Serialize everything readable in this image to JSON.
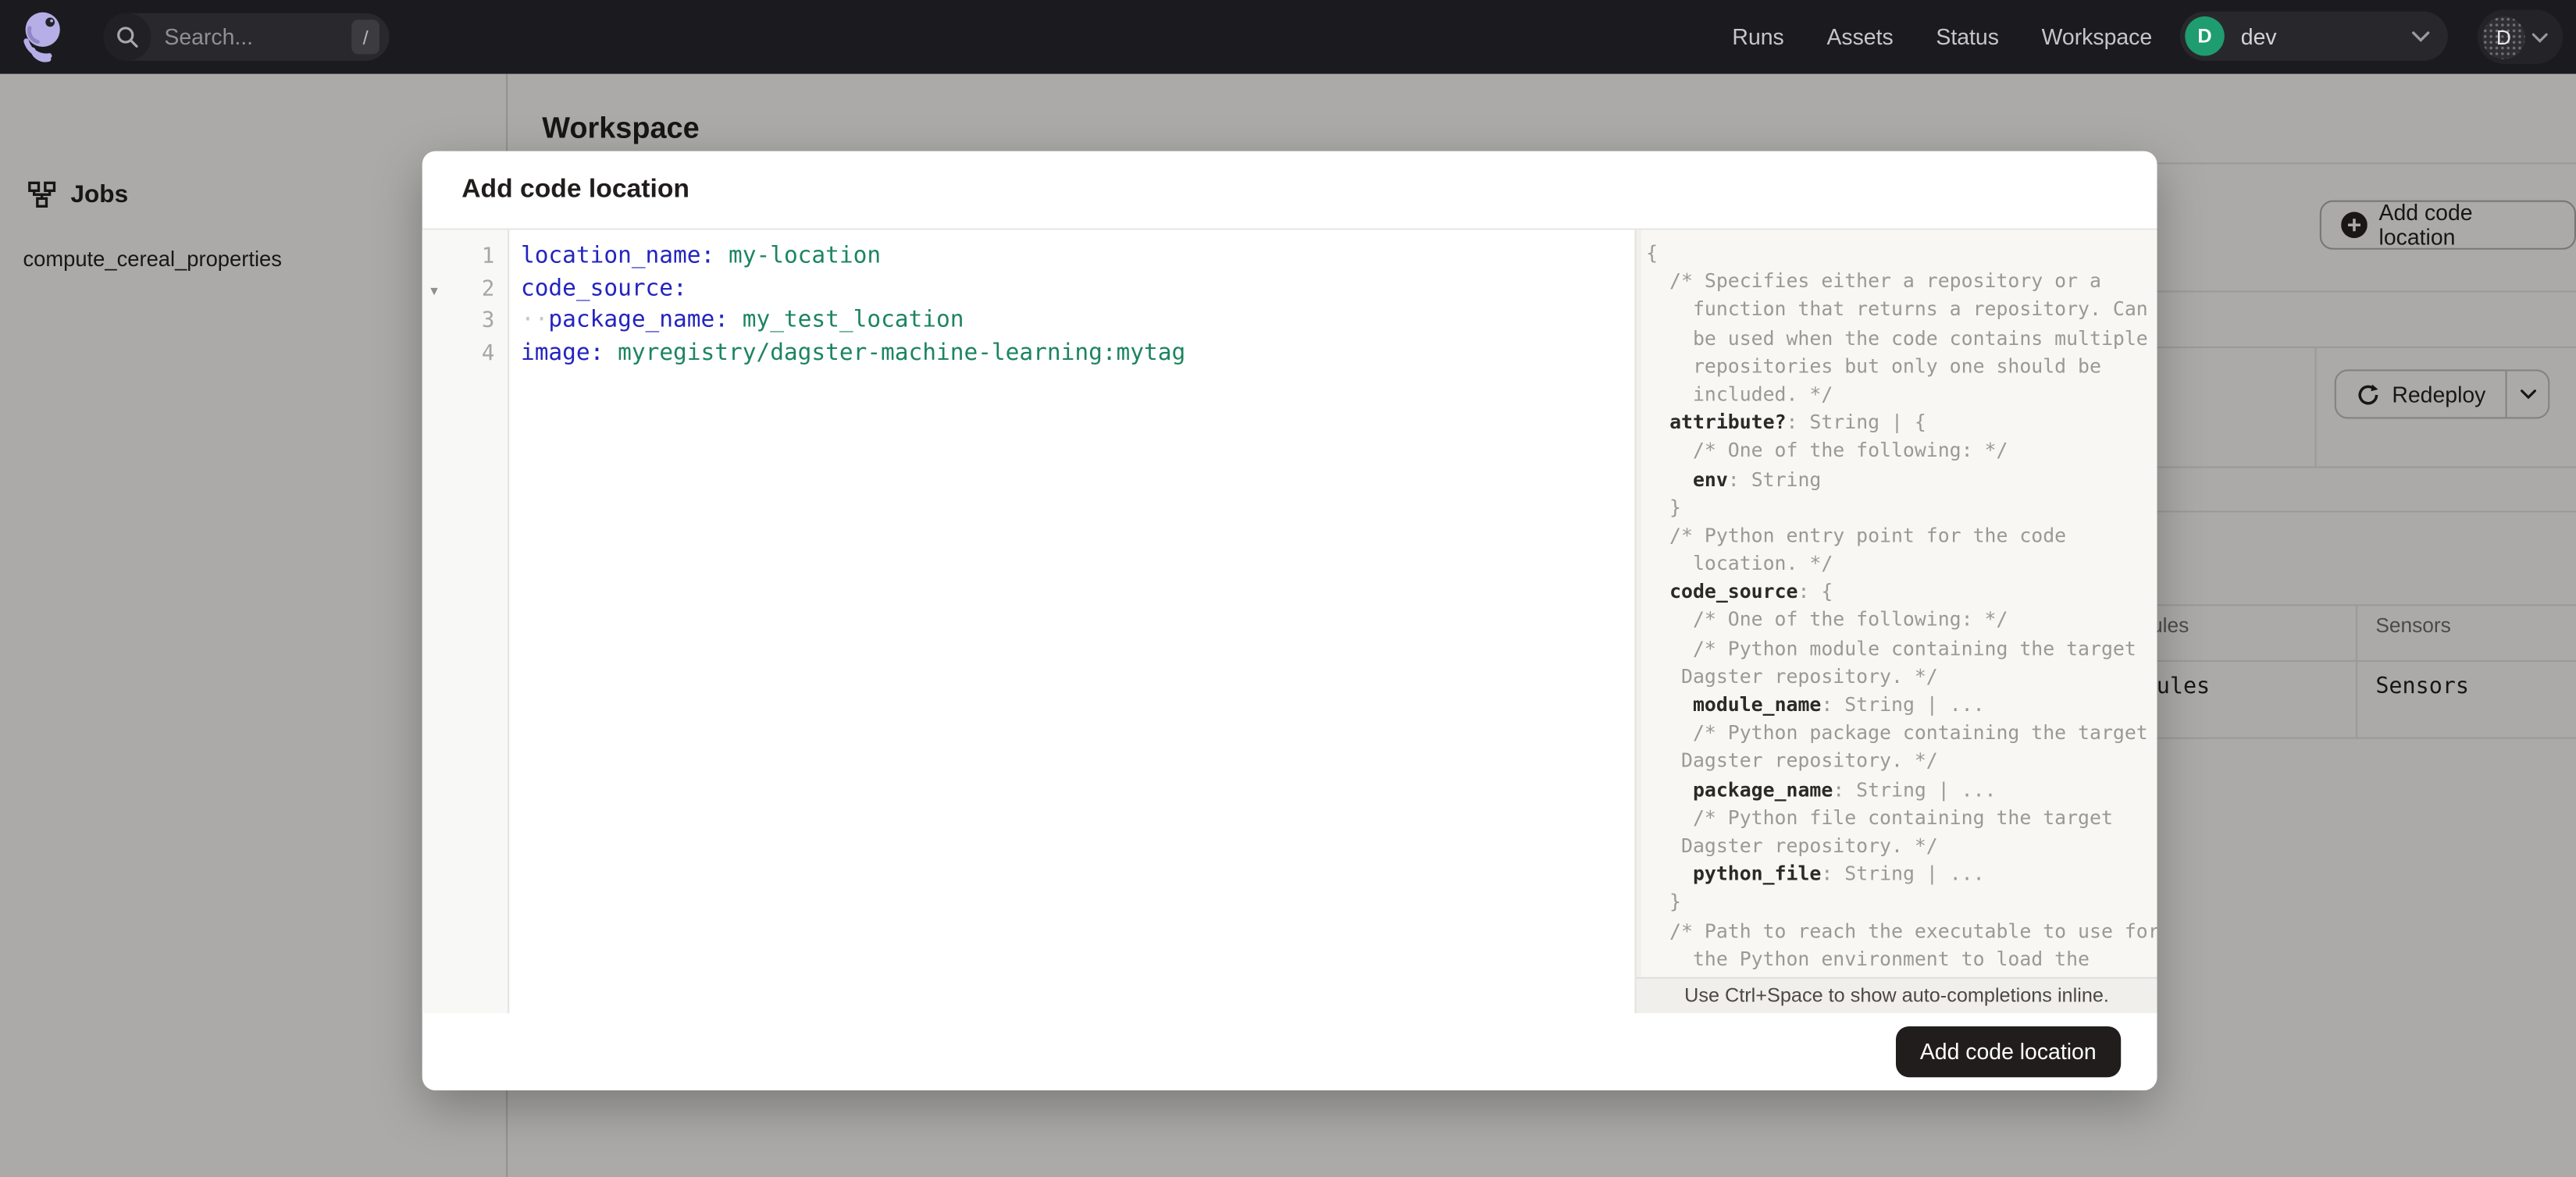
{
  "navbar": {
    "search_placeholder": "Search...",
    "search_shortcut": "/",
    "links": [
      "Runs",
      "Assets",
      "Status",
      "Workspace"
    ],
    "deployment": {
      "initial": "D",
      "name": "dev"
    },
    "user_initial": "D"
  },
  "sidebar": {
    "section": "Jobs",
    "items": [
      "compute_cereal_properties"
    ]
  },
  "workspace": {
    "title": "Workspace",
    "add_button": "Add code location",
    "redeploy_button": "Redeploy",
    "table": {
      "headers": [
        "Schedules",
        "Sensors"
      ],
      "row": [
        "Schedules",
        "Sensors"
      ]
    }
  },
  "modal": {
    "title": "Add code location",
    "submit_button": "Add code location",
    "editor": {
      "lines": [
        {
          "num": "1",
          "fold": false,
          "seg": [
            {
              "t": "key",
              "s": "location_name:"
            },
            {
              "t": "sp",
              "s": " "
            },
            {
              "t": "val",
              "s": "my-location"
            }
          ]
        },
        {
          "num": "2",
          "fold": true,
          "seg": [
            {
              "t": "key",
              "s": "code_source:"
            }
          ]
        },
        {
          "num": "3",
          "fold": false,
          "seg": [
            {
              "t": "dot",
              "s": "··"
            },
            {
              "t": "key",
              "s": "package_name:"
            },
            {
              "t": "sp",
              "s": " "
            },
            {
              "t": "val",
              "s": "my_test_location"
            }
          ]
        },
        {
          "num": "4",
          "fold": false,
          "seg": [
            {
              "t": "key",
              "s": "image:"
            },
            {
              "t": "sp",
              "s": " "
            },
            {
              "t": "val",
              "s": "myregistry/dagster-machine-learning:mytag"
            }
          ]
        }
      ]
    },
    "schema": {
      "lines": [
        {
          "seg": [
            {
              "t": "c",
              "s": "{"
            }
          ]
        },
        {
          "seg": [
            {
              "t": "c",
              "s": "  /* Specifies either a repository or a"
            }
          ]
        },
        {
          "seg": [
            {
              "t": "c",
              "s": "    function that returns a repository. Can"
            }
          ]
        },
        {
          "seg": [
            {
              "t": "c",
              "s": "    be used when the code contains multiple"
            }
          ]
        },
        {
          "seg": [
            {
              "t": "c",
              "s": "    repositories but only one should be"
            }
          ]
        },
        {
          "seg": [
            {
              "t": "c",
              "s": "    included. */"
            }
          ]
        },
        {
          "seg": [
            {
              "t": "c",
              "s": "  "
            },
            {
              "t": "k",
              "s": "attribute?"
            },
            {
              "t": "c",
              "s": ": String | {"
            }
          ]
        },
        {
          "seg": [
            {
              "t": "c",
              "s": "    /* One of the following: */"
            }
          ]
        },
        {
          "seg": [
            {
              "t": "c",
              "s": "    "
            },
            {
              "t": "k",
              "s": "env"
            },
            {
              "t": "c",
              "s": ": String"
            }
          ]
        },
        {
          "seg": [
            {
              "t": "c",
              "s": "  }"
            }
          ]
        },
        {
          "seg": [
            {
              "t": "c",
              "s": "  /* Python entry point for the code"
            }
          ]
        },
        {
          "seg": [
            {
              "t": "c",
              "s": "    location. */"
            }
          ]
        },
        {
          "seg": [
            {
              "t": "c",
              "s": "  "
            },
            {
              "t": "k",
              "s": "code_source"
            },
            {
              "t": "c",
              "s": ": {"
            }
          ]
        },
        {
          "seg": [
            {
              "t": "c",
              "s": "    /* One of the following: */"
            }
          ]
        },
        {
          "seg": [
            {
              "t": "c",
              "s": "    /* Python module containing the target"
            }
          ]
        },
        {
          "seg": [
            {
              "t": "c",
              "s": "   Dagster repository. */"
            }
          ]
        },
        {
          "seg": [
            {
              "t": "c",
              "s": "    "
            },
            {
              "t": "k",
              "s": "module_name"
            },
            {
              "t": "c",
              "s": ": String | ..."
            }
          ]
        },
        {
          "seg": [
            {
              "t": "c",
              "s": "    /* Python package containing the target"
            }
          ]
        },
        {
          "seg": [
            {
              "t": "c",
              "s": "   Dagster repository. */"
            }
          ]
        },
        {
          "seg": [
            {
              "t": "c",
              "s": "    "
            },
            {
              "t": "k",
              "s": "package_name"
            },
            {
              "t": "c",
              "s": ": String | ..."
            }
          ]
        },
        {
          "seg": [
            {
              "t": "c",
              "s": "    /* Python file containing the target"
            }
          ]
        },
        {
          "seg": [
            {
              "t": "c",
              "s": "   Dagster repository. */"
            }
          ]
        },
        {
          "seg": [
            {
              "t": "c",
              "s": "    "
            },
            {
              "t": "k",
              "s": "python_file"
            },
            {
              "t": "c",
              "s": ": String | ..."
            }
          ]
        },
        {
          "seg": [
            {
              "t": "c",
              "s": "  }"
            }
          ]
        },
        {
          "seg": [
            {
              "t": "c",
              "s": "  /* Path to reach the executable to use for"
            }
          ]
        },
        {
          "seg": [
            {
              "t": "c",
              "s": "    the Python environment to load the"
            }
          ]
        }
      ],
      "hint": "Use Ctrl+Space to show auto-completions inline."
    }
  },
  "colors": {
    "navbar_bg": "#1b1b1f",
    "deployment_green": "#1f9d70",
    "logo_lavender": "#b6aee6",
    "yaml_key_blue": "#2324c0",
    "yaml_value_teal": "#1c855f",
    "submit_button_bg": "#211d1d"
  },
  "icons": {
    "search-icon": "magnifier",
    "chevron-down-icon": "v",
    "jobs-icon": "workflow-merge",
    "plus-circle-icon": "+",
    "refresh-icon": "circular-arrow",
    "fold-caret-icon": "triangle-down"
  }
}
